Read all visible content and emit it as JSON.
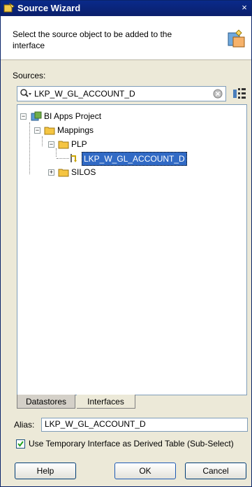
{
  "window": {
    "title": "Source Wizard",
    "close_glyph": "×"
  },
  "header": {
    "description": "Select the source object to be added to the interface"
  },
  "sources_label": "Sources:",
  "search": {
    "value": "LKP_W_GL_ACCOUNT_D"
  },
  "tree": {
    "root": "BI Apps Project",
    "mappings": "Mappings",
    "plp": "PLP",
    "selected_item": "LKP_W_GL_ACCOUNT_D",
    "silos": "SILOS"
  },
  "tabs": [
    {
      "label": "Datastores"
    },
    {
      "label": "Interfaces"
    }
  ],
  "alias": {
    "label": "Alias:",
    "value": "LKP_W_GL_ACCOUNT_D"
  },
  "temp_interface": {
    "label": "Use Temporary Interface as Derived Table (Sub-Select)",
    "checked": true
  },
  "buttons": {
    "help": "Help",
    "ok": "OK",
    "cancel": "Cancel"
  }
}
